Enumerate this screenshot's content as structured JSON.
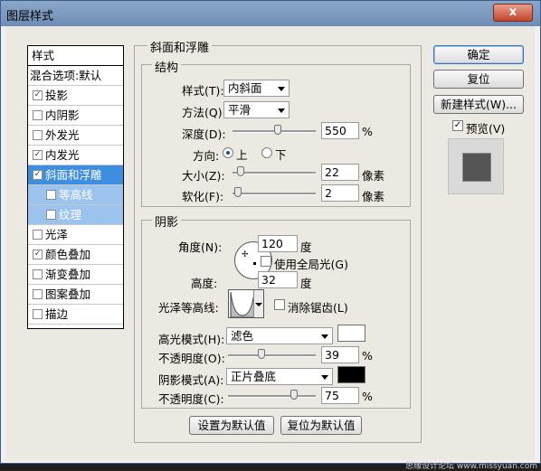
{
  "window": {
    "title": "图层样式",
    "close": "x"
  },
  "style_list": {
    "header": "样式",
    "blend": "混合选项:默认",
    "items": [
      {
        "label": "投影",
        "checked": true
      },
      {
        "label": "内阴影",
        "checked": false
      },
      {
        "label": "外发光",
        "checked": false
      },
      {
        "label": "内发光",
        "checked": true
      },
      {
        "label": "斜面和浮雕",
        "checked": true
      },
      {
        "label": "等高线",
        "checked": false
      },
      {
        "label": "纹理",
        "checked": false
      },
      {
        "label": "光泽",
        "checked": false
      },
      {
        "label": "颜色叠加",
        "checked": true
      },
      {
        "label": "渐变叠加",
        "checked": false
      },
      {
        "label": "图案叠加",
        "checked": false
      },
      {
        "label": "描边",
        "checked": false
      }
    ],
    "check_mark": "✓"
  },
  "bevel": {
    "title": "斜面和浮雕",
    "structure": {
      "title": "结构",
      "style_label": "样式(T):",
      "style_value": "内斜面",
      "method_label": "方法(Q):",
      "method_value": "平滑",
      "depth_label": "深度(D):",
      "depth_value": "550",
      "depth_unit": "%",
      "depth_level": 0.55,
      "direction_label": "方向:",
      "dir_up": "上",
      "dir_down": "下",
      "size_label": "大小(Z):",
      "size_value": "22",
      "size_unit": "像素",
      "soften_label": "软化(F):",
      "soften_value": "2",
      "soften_unit": "像素"
    },
    "shading": {
      "title": "阴影",
      "angle_label": "角度(N):",
      "angle_value": "120",
      "angle_unit": "度",
      "global_light": "使用全局光(G)",
      "altitude_label": "高度:",
      "altitude_value": "32",
      "altitude_unit": "度",
      "gloss_label": "光泽等高线:",
      "antialias": "消除锯齿(L)",
      "highlight_label": "高光模式(H):",
      "highlight_mode": "滤色",
      "highlight_color": "#ffffff",
      "hl_opacity_label": "不透明度(O):",
      "hl_opacity_value": "39",
      "hl_opacity_unit": "%",
      "shadow_label": "阴影模式(A):",
      "shadow_mode": "正片叠底",
      "shadow_color": "#000000",
      "sh_opacity_label": "不透明度(C):",
      "sh_opacity_value": "75",
      "sh_opacity_unit": "%"
    },
    "make_default": "设置为默认值",
    "reset_default": "复位为默认值"
  },
  "buttons": {
    "ok": "确定",
    "reset": "复位",
    "new_style": "新建样式(W)...",
    "preview": "预览(V)"
  },
  "watermark": "思缘设计论坛 www.missyuan.com"
}
